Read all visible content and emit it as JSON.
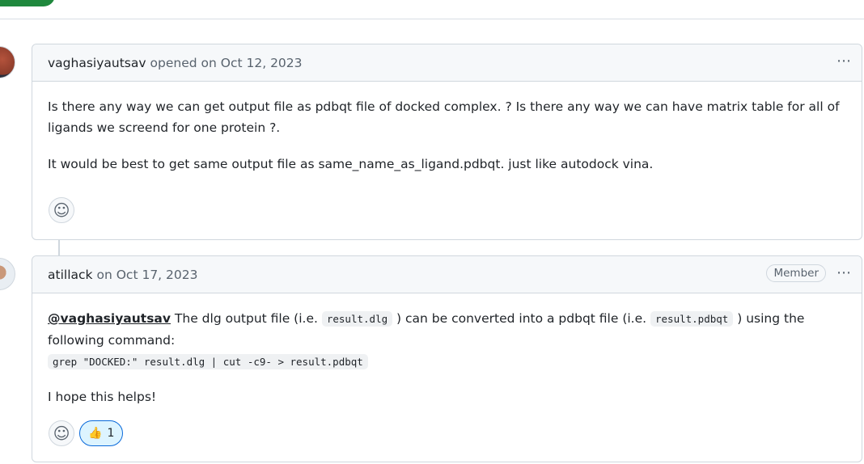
{
  "comments": [
    {
      "author": "vaghasiyautsav",
      "meta": "opened on Oct 12, 2023",
      "paragraphs": [
        "Is there any way we can get output file as pdbqt file of docked complex. ? Is there any way we can have matrix table for all of ligands we screend for one protein ?.",
        "It would be best to get same output file as same_name_as_ligand.pdbqt. just like autodock vina."
      ]
    },
    {
      "author": "atillack",
      "meta": "on Oct 17, 2023",
      "badge": "Member",
      "mention": "@vaghasiyautsav",
      "t1": " The dlg output file (i.e. ",
      "code1": "result.dlg",
      "t2": " ) can be converted into a pdbqt file (i.e. ",
      "code2": "result.pdbqt",
      "t3": " ) using the following command:",
      "command": "grep \"DOCKED:\" result.dlg | cut -c9- > result.pdbqt",
      "closing": "I hope this helps!",
      "reaction": {
        "emoji": "👍",
        "count": "1"
      }
    }
  ],
  "icons": {
    "more": "⋯",
    "smiley": "☺"
  }
}
